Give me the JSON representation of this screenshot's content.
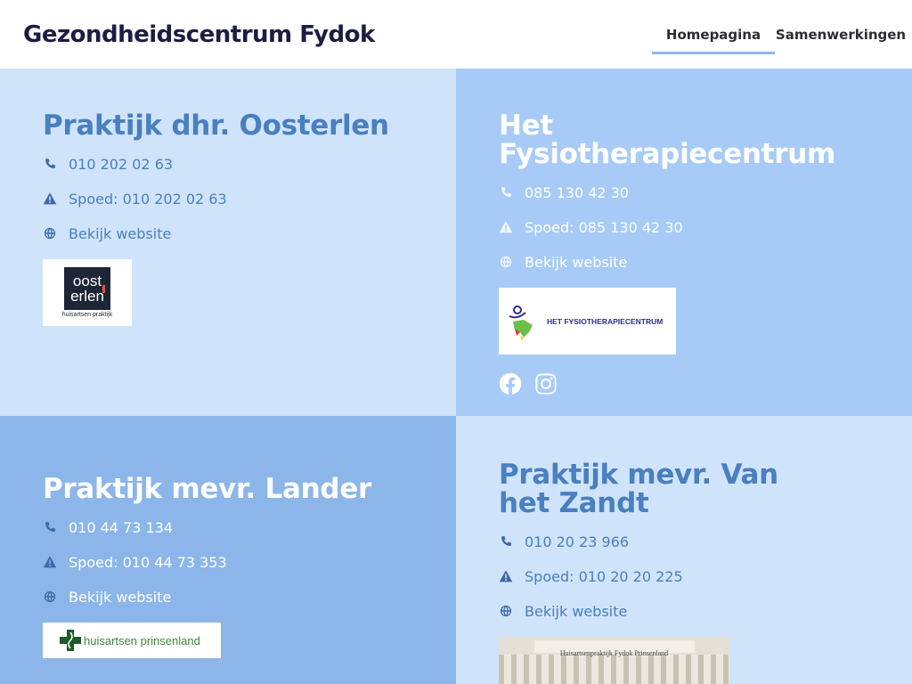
{
  "header": {
    "title": "Gezondheidscentrum Fydok",
    "nav": [
      {
        "label": "Homepagina",
        "active": true
      },
      {
        "label": "Samenwerkingen",
        "active": false
      }
    ]
  },
  "cards": [
    {
      "name": "Praktijk dhr. Oosterlen",
      "phone": "010 202 02 63",
      "emergency": "Spoed: 010 202 02 63",
      "website": "Bekijk website",
      "logo": {
        "line1": "oost",
        "line2": "erlen",
        "caption": "huisartsen praktijk"
      }
    },
    {
      "name": "Het Fysiotherapiecentrum",
      "phone": "085 130 42 30",
      "emergency": "Spoed: 085 130 42 30",
      "website": "Bekijk website",
      "logo": {
        "text": "HET FYSIOTHERAPIECENTRUM"
      },
      "socials": [
        "facebook-icon",
        "instagram-icon"
      ]
    },
    {
      "name": "Praktijk mevr. Lander",
      "phone": "010 44 73 134",
      "emergency": "Spoed: 010 44 73 353",
      "website": "Bekijk website",
      "logo": {
        "text": "huisartsen prinsenland"
      }
    },
    {
      "name": "Praktijk mevr. Van het Zandt",
      "phone": "010 20 23 966",
      "emergency": "Spoed: 010 20 20 225",
      "website": "Bekijk website",
      "logo": {
        "text": "Huisartsenpraktijk Fydok Prinsenland"
      }
    }
  ],
  "colors": {
    "card_light": "#cfe4fb",
    "card_mid": "#a7cbf6",
    "card_dark": "#8cb6ea",
    "heading_blue": "#4a7fc0",
    "title_navy": "#1b1d43"
  }
}
